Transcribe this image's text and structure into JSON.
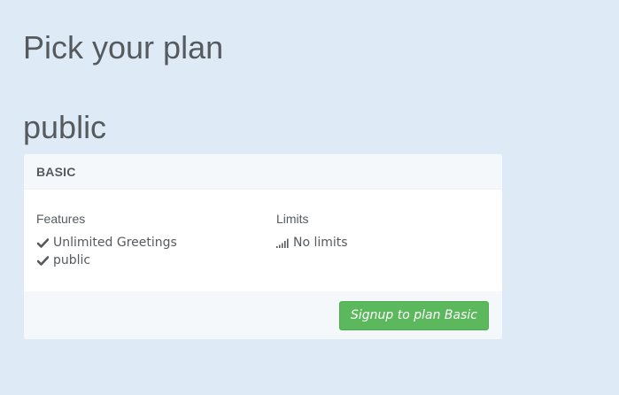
{
  "page": {
    "title": "Pick your plan"
  },
  "section": {
    "title": "public"
  },
  "plan": {
    "name": "BASIC",
    "features_heading": "Features",
    "features": [
      {
        "label": "Unlimited Greetings",
        "icon": "check-icon"
      },
      {
        "label": "public",
        "icon": "check-icon"
      }
    ],
    "limits_heading": "Limits",
    "limits": [
      {
        "label": "No limits",
        "icon": "signal-bars-icon"
      }
    ],
    "signup_label": "Signup to plan Basic"
  },
  "colors": {
    "background": "#deeaf5",
    "card": "#ffffff",
    "card_header": "#f5f8fb",
    "button": "#5cb85c",
    "text": "#555a5f"
  }
}
